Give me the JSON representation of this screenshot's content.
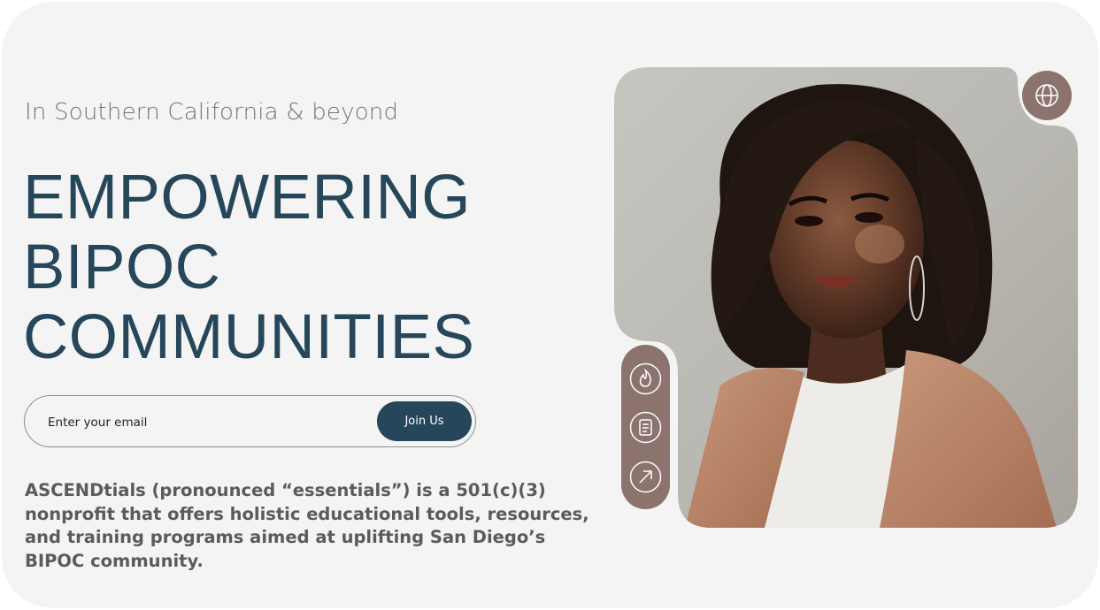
{
  "hero": {
    "subtitle": "In Southern California & beyond",
    "headline": [
      "EMPOWERING",
      "BIPOC",
      "COMMUNITIES"
    ],
    "description": "ASCENDtials (pronounced “essentials”) is a 501(c)(3) nonprofit that offers holistic educational tools, resources, and training programs aimed at uplifting San Diego’s BIPOC community."
  },
  "signup": {
    "email_placeholder": "Enter your email",
    "email_value": "",
    "join_label": "Join Us"
  },
  "side_tools": [
    {
      "icon": "flame-icon"
    },
    {
      "icon": "document-icon"
    },
    {
      "icon": "arrow-up-right-icon"
    }
  ],
  "corner_button": {
    "icon": "globe-icon"
  },
  "photo": {
    "subject": "portrait-photo"
  },
  "colors": {
    "accent": "#26465a",
    "icon_pill": "#8d736e",
    "background": "#f4f4f4",
    "text_muted": "#5b5b5b"
  }
}
